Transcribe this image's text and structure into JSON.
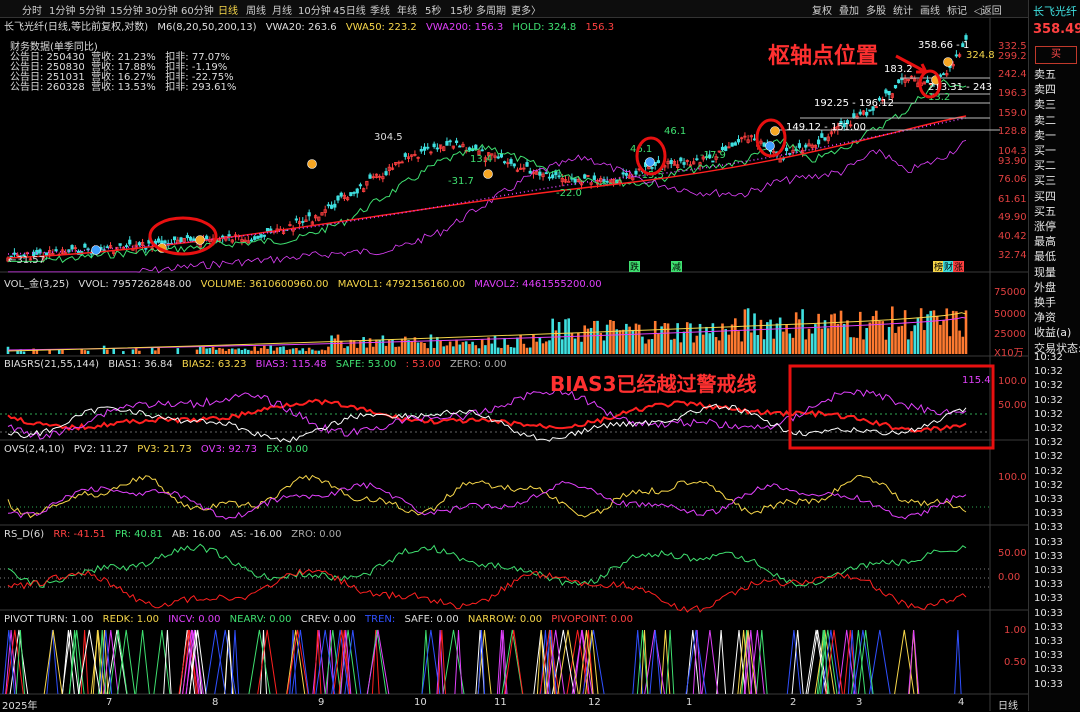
{
  "toolbar": {
    "periods": [
      "分时",
      "1分钟",
      "5分钟",
      "15分钟",
      "30分钟",
      "60分钟",
      "日线",
      "周线",
      "月线",
      "10分钟",
      "45日线",
      "季线",
      "年线",
      "5秒",
      "15秒",
      "多周期",
      "更多〉"
    ],
    "active_period": "日线",
    "right_items": [
      "复权",
      "叠加",
      "多股",
      "统计",
      "画线",
      "标记",
      "◁返回"
    ]
  },
  "stock": {
    "name": "长飞光纤",
    "price": "358.49",
    "buy_label": "买"
  },
  "main_chart": {
    "title": "长飞光纤(日线,等比前复权,对数)",
    "ma_label": "M6(8,20,50,200,13)",
    "vwa20": "VWA20: 263.6",
    "vwa50": "VWA50: 223.2",
    "vwa200": "VWA200: 156.3",
    "hold": "HOLD: 324.8",
    "hold2": "156.3",
    "fin_title": "财务数据(单季同比)",
    "fin_rows": [
      "公告日: 250430  营收: 21.23%   扣非: 77.07%",
      "公告日: 250830  营收: 17.88%   扣非: -1.19%",
      "公告日: 251031  营收: 16.27%   扣非: -22.75%",
      "公告日: 260328  营收: 13.53%   扣非: 293.61%"
    ],
    "price_labels": [
      "←31.57",
      "304.5",
      "-31.7",
      "13.4",
      "-22.0",
      "46.1",
      "-15.5",
      "46.1",
      "-17.9",
      "149.12 - 151.00",
      "192.25 - 196.12",
      "183.2",
      "213.31 - 243",
      "13.2",
      "358.66 - 1",
      "324.8"
    ],
    "y_axis": [
      "332.5",
      "299.2",
      "242.4",
      "196.3",
      "159.0",
      "128.8",
      "104.3",
      "93.90",
      "76.06",
      "61.61",
      "49.90",
      "40.42",
      "32.74"
    ],
    "bottom_marks": [
      "跌",
      "减",
      "榜",
      "财",
      "涨"
    ]
  },
  "annotations": {
    "pivot": "枢轴点位置",
    "bias3": "BIAS3已经越过警戒线"
  },
  "volume": {
    "title": "VOL_金(3,25)",
    "vvol": "VVOL: 7957262848.00",
    "volume": "VOLUME: 3610600960.00",
    "mavol1": "MAVOL1: 4792156160.00",
    "mavol2": "MAVOL2: 4461555200.00",
    "y_axis": [
      "75000",
      "50000",
      "25000",
      "X10万"
    ]
  },
  "bias": {
    "title": "BIASRS(21,55,144)",
    "bias1": "BIAS1: 36.84",
    "bias2": "BIAS2: 63.23",
    "bias3": "BIAS3: 115.48",
    "safe": "SAFE: 53.00",
    "safe2": ": 53.00",
    "zero": "ZERO: 0.00",
    "y_axis": [
      "100.0",
      "50.00"
    ],
    "tag": "115.4"
  },
  "ovs": {
    "title": "OVS(2,4,10)",
    "pv2": "PV2: 11.27",
    "pv3": "PV3: 21.73",
    "ov3": "OV3: 92.73",
    "ex": "EX: 0.00",
    "y_axis": [
      "100.0"
    ]
  },
  "rsd": {
    "title": "RS_D(6)",
    "rr": "RR: -41.51",
    "pr": "PR: 40.81",
    "ab": "AB: 16.00",
    "as": "AS: -16.00",
    "zro": "ZRO: 0.00",
    "y_axis": [
      "50.00",
      "0.00"
    ]
  },
  "pivot": {
    "title": "PIVOT TURN: 1.00",
    "redk": "REDK: 1.00",
    "incv": "INCV: 0.00",
    "nearv": "NEARV: 0.00",
    "crev": "CREV: 0.00",
    "tren": "TREN:",
    "safe": "SAFE: 0.00",
    "narrow": "NARROW: 0.00",
    "pivopoint": "PIVOPOINT: 0.00",
    "y_axis": [
      "1.00",
      "0.50"
    ]
  },
  "x_axis": [
    "2025年",
    "7",
    "8",
    "9",
    "10",
    "11",
    "12",
    "1",
    "2",
    "3",
    "4"
  ],
  "x_axis_period": "日线",
  "side": {
    "order_labels": [
      "卖五",
      "卖四",
      "卖三",
      "卖二",
      "卖一",
      "买一",
      "买二",
      "买三",
      "买四",
      "买五",
      "涨停",
      "最高",
      "最低",
      "现量",
      "外盘",
      "换手",
      "净资",
      "收益(a)",
      "交易状态:"
    ],
    "times": [
      "10:32",
      "10:32",
      "10:32",
      "10:32",
      "10:32",
      "10:32",
      "10:32",
      "10:32",
      "10:32",
      "10:32",
      "10:33",
      "10:33",
      "10:33",
      "10:33",
      "10:33",
      "10:33",
      "10:33",
      "10:33",
      "10:33",
      "10:33",
      "10:33",
      "10:33",
      "10:33",
      "10:33"
    ]
  },
  "colors": {
    "up": "#ff4040",
    "down": "#3fe0e0",
    "accent": "#f6d64a",
    "magenta": "#e040fb"
  }
}
